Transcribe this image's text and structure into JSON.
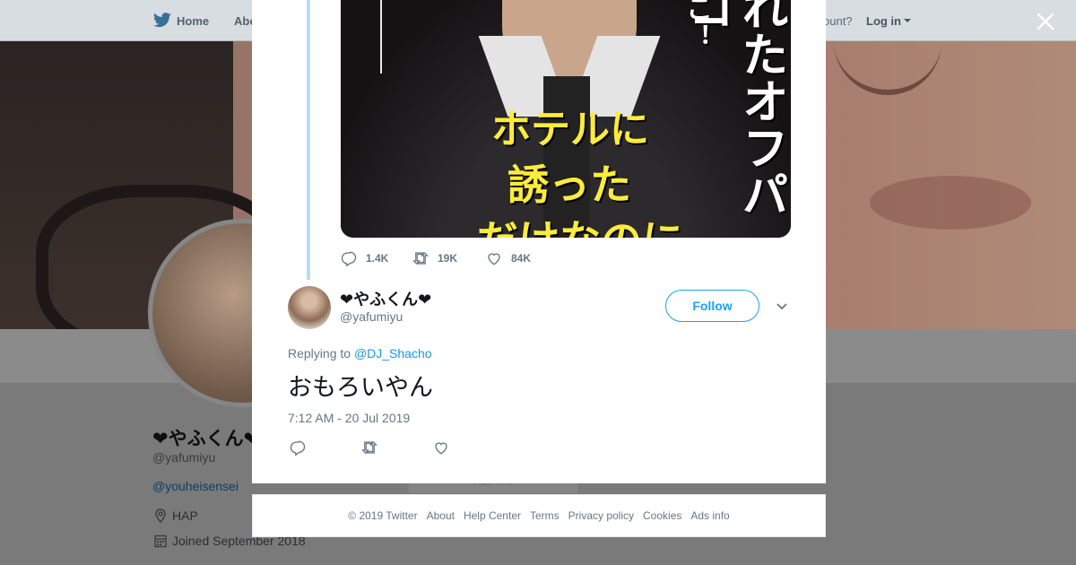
{
  "topnav": {
    "home_label": "Home",
    "about_label": "Abo",
    "have_account": "ccount?",
    "login_label": "Log in"
  },
  "profile": {
    "name": "❤やふくん❤",
    "handle": "@yafumiyu",
    "link": "@youheisensei",
    "location": "HAP",
    "joined": "Joined September 2018",
    "ads_info": "Ads info"
  },
  "original_tweet": {
    "media": {
      "yellow_line1": "ホテルに",
      "yellow_line2": "誘った",
      "yellow_line3": "だけなのに",
      "white_vertical": "れたオフパコ",
      "white_small": "こ！"
    },
    "stats": {
      "replies": "1.4K",
      "retweets": "19K",
      "likes": "84K"
    }
  },
  "reply": {
    "name": "❤やふくん❤",
    "handle": "@yafumiyu",
    "follow_label": "Follow",
    "replying_prefix": "Replying to ",
    "replying_to": "@DJ_Shacho",
    "text": "おもろいやん",
    "timestamp": "7:12 AM - 20 Jul 2019"
  },
  "footer": {
    "links": [
      "© 2019 Twitter",
      "About",
      "Help Center",
      "Terms",
      "Privacy policy",
      "Cookies",
      "Ads info"
    ]
  },
  "colors": {
    "accent": "#1da1f2",
    "mention": "#1b95e0",
    "muted": "#657786",
    "thread_line": "#b9dcf2",
    "media_yellow": "#ffec3a"
  },
  "icons": {
    "close": "close-icon",
    "reply": "reply-icon",
    "retweet": "retweet-icon",
    "like": "heart-icon",
    "caret": "chevron-down-icon",
    "location": "location-pin-icon",
    "calendar": "calendar-icon",
    "logo": "twitter-bird-icon"
  }
}
